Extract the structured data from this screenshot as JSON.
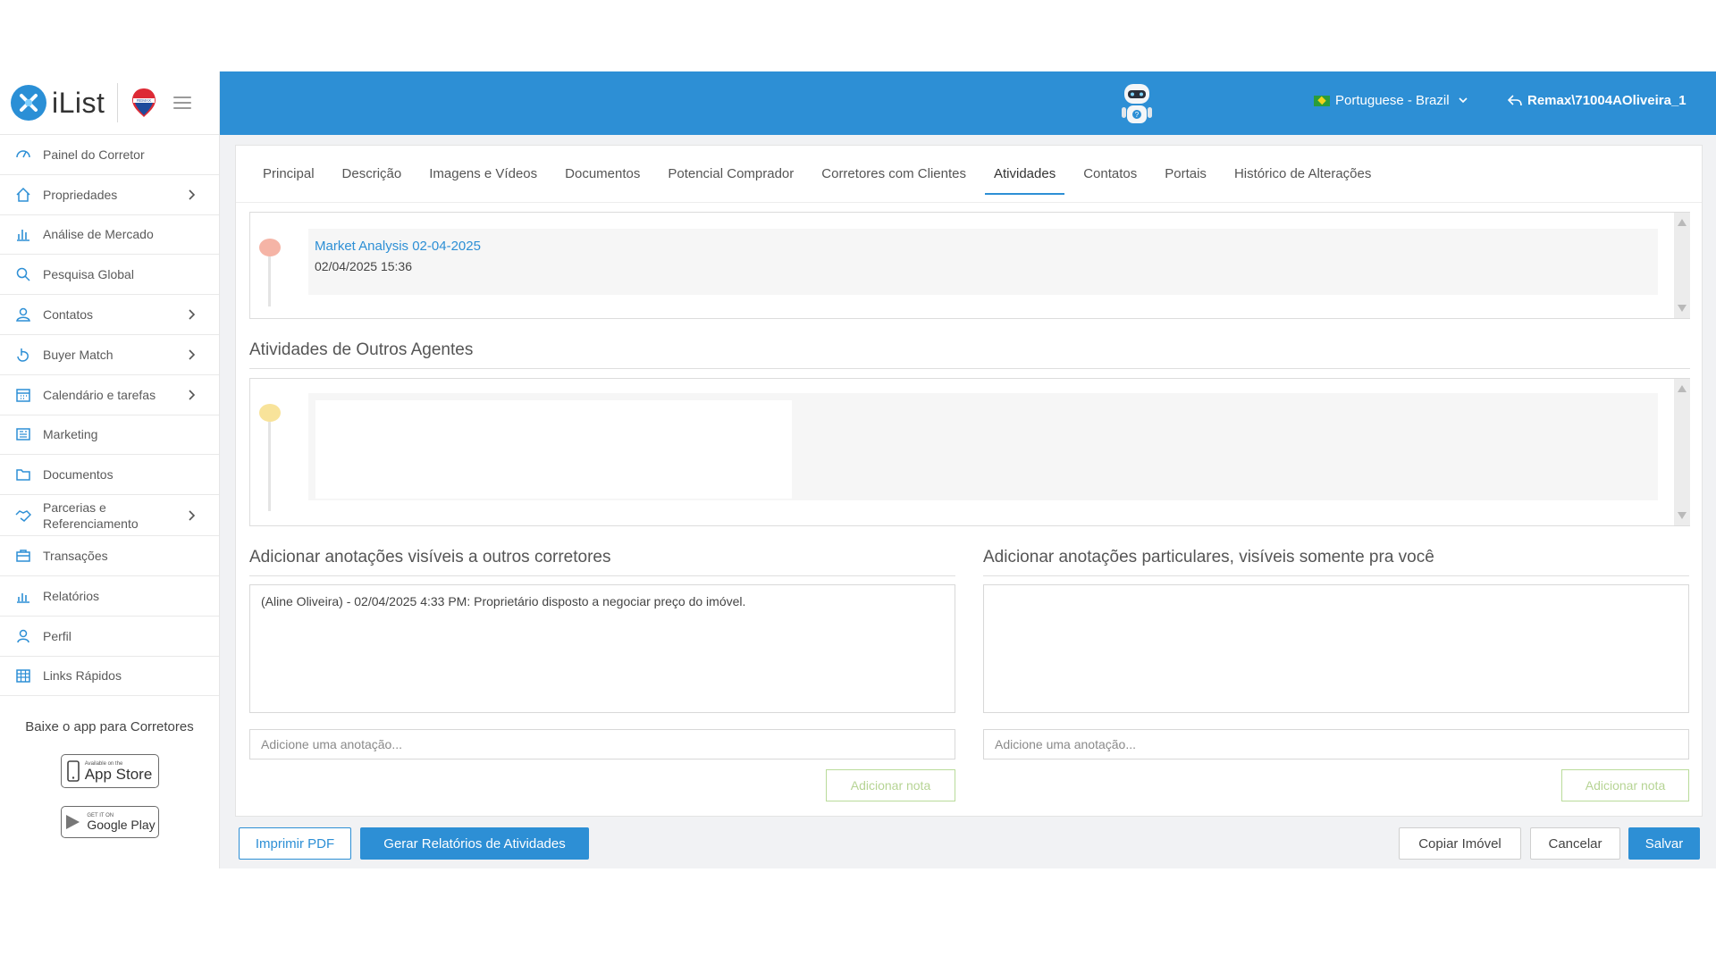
{
  "brand": {
    "name": "iList",
    "accent": "#2d8fd5"
  },
  "sidebar": {
    "items": [
      {
        "label": "Painel do Corretor",
        "icon": "gauge-icon",
        "has_submenu": false
      },
      {
        "label": "Propriedades",
        "icon": "home-icon",
        "has_submenu": true
      },
      {
        "label": "Análise de Mercado",
        "icon": "bar-chart-icon",
        "has_submenu": false
      },
      {
        "label": "Pesquisa Global",
        "icon": "search-icon",
        "has_submenu": false
      },
      {
        "label": "Contatos",
        "icon": "contacts-icon",
        "has_submenu": true
      },
      {
        "label": "Buyer Match",
        "icon": "hand-pointer-icon",
        "has_submenu": true
      },
      {
        "label": "Calendário e tarefas",
        "icon": "calendar-icon",
        "has_submenu": true
      },
      {
        "label": "Marketing",
        "icon": "newspaper-icon",
        "has_submenu": false
      },
      {
        "label": "Documentos",
        "icon": "folder-icon",
        "has_submenu": false
      },
      {
        "label": "Parcerias e Referenciamento",
        "icon": "handshake-icon",
        "has_submenu": true
      },
      {
        "label": "Transações",
        "icon": "briefcase-icon",
        "has_submenu": false
      },
      {
        "label": "Relatórios",
        "icon": "report-chart-icon",
        "has_submenu": false
      },
      {
        "label": "Perfil",
        "icon": "user-icon",
        "has_submenu": false
      },
      {
        "label": "Links Rápidos",
        "icon": "grid-calendar-icon",
        "has_submenu": false
      }
    ],
    "app_promo": {
      "title": "Baixe o app para Corretores",
      "app_store_small": "Available on the",
      "app_store_big": "App Store",
      "google_play_small": "GET IT ON",
      "google_play_big": "Google Play"
    }
  },
  "header": {
    "language": "Portuguese - Brazil",
    "user": "Remax\\71004AOliveira_1"
  },
  "tabs": [
    {
      "label": "Principal",
      "active": false
    },
    {
      "label": "Descrição",
      "active": false
    },
    {
      "label": "Imagens e Vídeos",
      "active": false
    },
    {
      "label": "Documentos",
      "active": false
    },
    {
      "label": "Potencial Comprador",
      "active": false
    },
    {
      "label": "Corretores com Clientes",
      "active": false
    },
    {
      "label": "Atividades",
      "active": true
    },
    {
      "label": "Contatos",
      "active": false
    },
    {
      "label": "Portais",
      "active": false
    },
    {
      "label": "Histórico de Alterações",
      "active": false
    }
  ],
  "activities": {
    "items": [
      {
        "title": "Market Analysis 02-04-2025",
        "date": "02/04/2025 15:36",
        "dot_color": "#f5b4a6"
      }
    ]
  },
  "other_agents": {
    "title": "Atividades de Outros Agentes",
    "dot_color": "#f8e39a"
  },
  "notes_public": {
    "title": "Adicionar anotações visíveis a outros corretores",
    "content": "(Aline Oliveira) - 02/04/2025 4:33 PM: Proprietário disposto a negociar preço do imóvel.",
    "input_placeholder": "Adicione uma anotação...",
    "button_label": "Adicionar nota"
  },
  "notes_private": {
    "title": "Adicionar anotações particulares, visíveis somente pra você",
    "content": "",
    "input_placeholder": "Adicione uma anotação...",
    "button_label": "Adicionar nota"
  },
  "footer": {
    "print_pdf": "Imprimir PDF",
    "generate_reports": "Gerar Relatórios de Atividades",
    "copy_property": "Copiar Imóvel",
    "cancel": "Cancelar",
    "save": "Salvar"
  }
}
